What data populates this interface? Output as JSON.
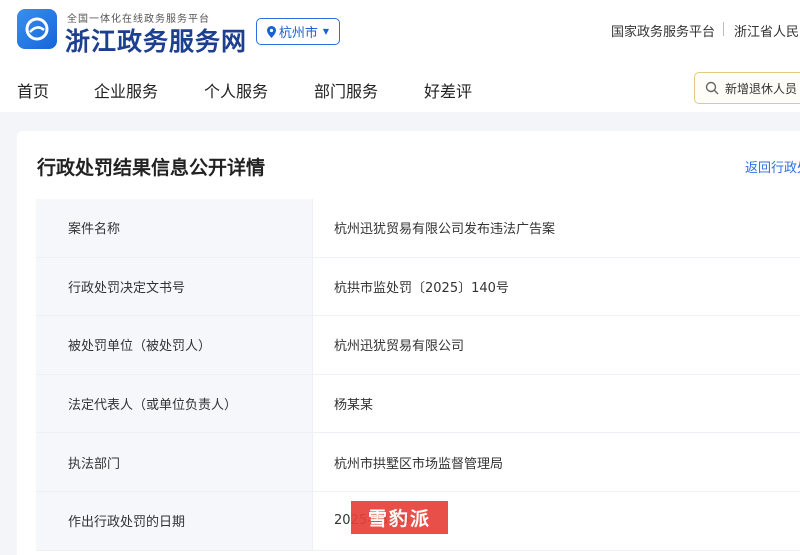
{
  "header": {
    "site_subtitle": "全国一体化在线政务服务平台",
    "site_title": "浙江政务服务网",
    "city": "杭州市",
    "top_links": [
      "国家政务服务平台",
      "浙江省人民"
    ]
  },
  "nav": {
    "items": [
      "首页",
      "企业服务",
      "个人服务",
      "部门服务",
      "好差评"
    ],
    "search_value": "新增退休人员"
  },
  "detail": {
    "title": "行政处罚结果信息公开详情",
    "back_link": "返回行政处",
    "rows": [
      {
        "label": "案件名称",
        "value": "杭州迅犹贸易有限公司发布违法广告案"
      },
      {
        "label": "行政处罚决定文书号",
        "value": "杭拱市监处罚〔2025〕140号"
      },
      {
        "label": "被处罚单位（被处罚人）",
        "value": "杭州迅犹贸易有限公司"
      },
      {
        "label": "法定代表人（或单位负责人）",
        "value": "杨某某"
      },
      {
        "label": "执法部门",
        "value": "杭州市拱墅区市场监督管理局"
      },
      {
        "label": "作出行政处罚的日期",
        "value": "2025-03-26"
      }
    ]
  },
  "watermark": "雪豹派",
  "colors": {
    "brand_blue": "#1c3f8f",
    "link_blue": "#2d6fe0",
    "watermark_red": "#e8413a"
  },
  "icons": [
    "logo-icon",
    "location-pin-icon",
    "caret-down-icon",
    "search-icon"
  ]
}
